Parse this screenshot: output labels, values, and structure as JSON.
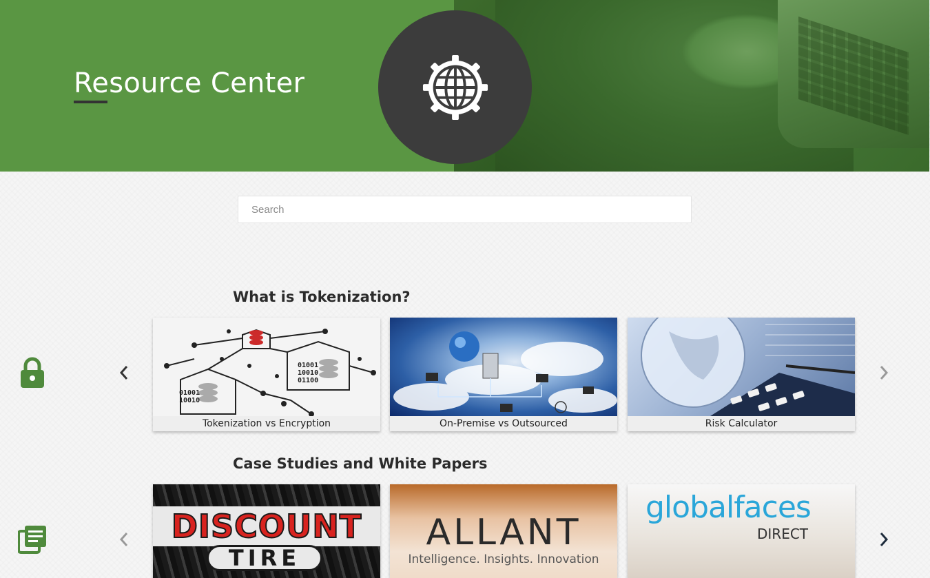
{
  "hero": {
    "title": "Resource Center",
    "icon": "globe-gear-icon"
  },
  "search": {
    "placeholder": "Search",
    "value": ""
  },
  "sections": [
    {
      "title": "What is Tokenization?",
      "side_icon": "lock-icon",
      "cards": [
        {
          "label": "Tokenization vs Encryption",
          "thumb": "tokenization-network-diagram"
        },
        {
          "label": "On-Premise vs Outsourced",
          "thumb": "cloud-network-globe"
        },
        {
          "label": "Risk Calculator",
          "thumb": "glass-globe-calculator"
        }
      ]
    },
    {
      "title": "Case Studies and White Papers",
      "side_icon": "document-list-icon",
      "cards": [
        {
          "logo_text": "DISCOUNT",
          "logo_subtext": "TIRE",
          "thumb": "discount-tire-logo"
        },
        {
          "logo_text": "ALLANT",
          "logo_subtext": "Intelligence. Insights. Innovation",
          "thumb": "allant-logo"
        },
        {
          "logo_text": "globalfaces",
          "logo_subtext": "DIRECT",
          "thumb": "globalfaces-direct-logo"
        }
      ]
    }
  ],
  "colors": {
    "brand_green": "#5a9643",
    "dark_circle": "#3c3c3c",
    "icon_green": "#4f8a3c"
  }
}
